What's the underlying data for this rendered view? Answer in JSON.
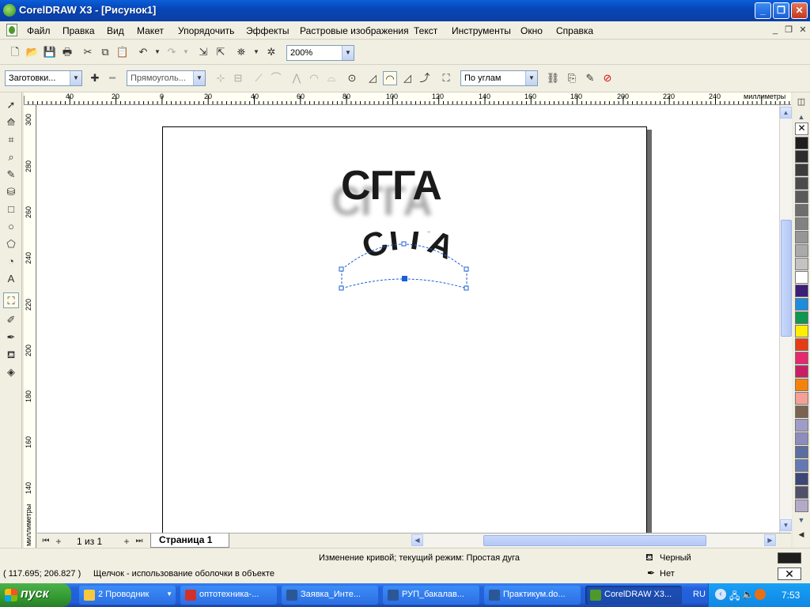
{
  "window": {
    "title": "CorelDRAW X3 - [Рисунок1]",
    "minimize_glyph": "_",
    "restore_glyph": "❐",
    "close_glyph": "✕"
  },
  "menu": {
    "items": [
      "Файл",
      "Правка",
      "Вид",
      "Макет",
      "Упорядочить",
      "Эффекты",
      "Растровые изображения",
      "Текст",
      "Инструменты",
      "Окно",
      "Справка"
    ]
  },
  "standard_toolbar": {
    "zoom_value": "200%"
  },
  "property_bar": {
    "presets_value": "Заготовки...",
    "shape_mode_value": "Прямоуголь...",
    "mapping_mode_value": "По углам"
  },
  "rulers": {
    "units_label": "миллиметры",
    "h_ticks": [
      "40",
      "20",
      "0",
      "20",
      "40",
      "60",
      "80",
      "100",
      "120",
      "140",
      "160",
      "180",
      "200",
      "220",
      "240"
    ],
    "v_ticks": [
      "300",
      "280",
      "260",
      "240",
      "220",
      "200",
      "180",
      "160",
      "140"
    ]
  },
  "canvas": {
    "text_top": "СГГА",
    "text_envelope": "СГГА"
  },
  "palette": {
    "colors": [
      "#1e1e1e",
      "#2d2d2d",
      "#3c3c3c",
      "#4b4b4b",
      "#5a5a5a",
      "#6e6e6e",
      "#828282",
      "#969696",
      "#aaaaaa",
      "#c3c3c3",
      "#ffffff",
      "#3c1e78",
      "#1e8cdc",
      "#0f9650",
      "#ffee00",
      "#e63c14",
      "#e6286e",
      "#c81e64",
      "#f5820a",
      "#f5a096",
      "#786450",
      "#a09cc8",
      "#8c8cbe",
      "#5a6ea0",
      "#6478b4",
      "#3c4678",
      "#505068",
      "#b4aac8"
    ]
  },
  "page_tabs": {
    "page_count": "1 из 1",
    "current_tab": "Страница 1"
  },
  "status": {
    "line1": "Изменение кривой; текущий режим: Простая дуга",
    "coords": "( 117.695; 206.827 )",
    "hint": "Щелчок - использование оболочки в объекте",
    "fill_label": "Черный",
    "outline_label": "Нет",
    "fill_color": "#1e1e1e"
  },
  "taskbar": {
    "start_label": "пуск",
    "tasks": [
      {
        "label": "2 Проводник",
        "icon_color": "#f5c842"
      },
      {
        "label": "оптотехника-...",
        "icon_color": "#d0312d"
      },
      {
        "label": "Заявка_Инте...",
        "icon_color": "#2b5797"
      },
      {
        "label": "РУП_бакалав...",
        "icon_color": "#2b5797"
      },
      {
        "label": "Практикум.do...",
        "icon_color": "#2b5797"
      },
      {
        "label": "CorelDRAW X3...",
        "icon_color": "#4d9a2a"
      }
    ],
    "lang": "RU",
    "clock": "7:53"
  }
}
